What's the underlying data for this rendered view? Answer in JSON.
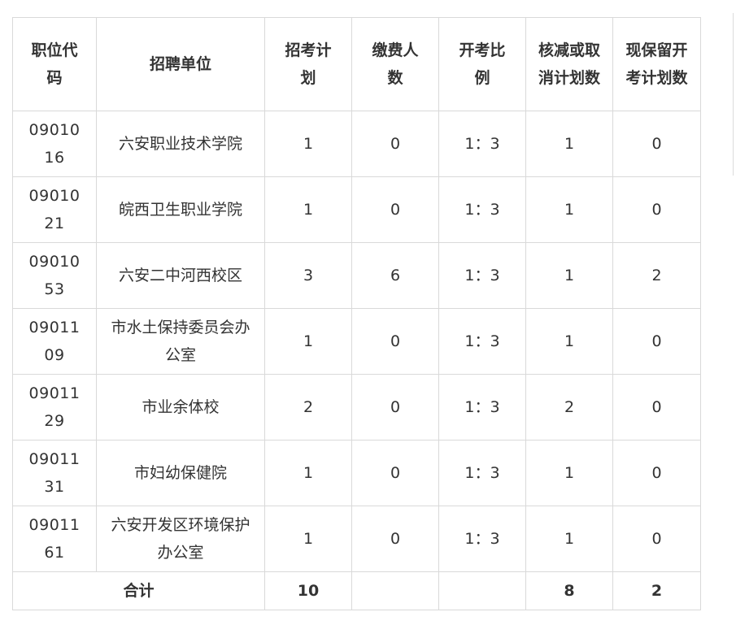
{
  "table": {
    "headers": {
      "code": "职位代码",
      "unit": "招聘单位",
      "plan": "招考计划",
      "paid": "缴费人数",
      "ratio": "开考比例",
      "cut": "核减或取消计划数",
      "kept": "现保留开考计划数"
    },
    "rows": [
      {
        "code": "0901016",
        "unit": "六安职业技术学院",
        "plan": "1",
        "paid": "0",
        "ratio": "1：3",
        "cut": "1",
        "kept": "0"
      },
      {
        "code": "0901021",
        "unit": "皖西卫生职业学院",
        "plan": "1",
        "paid": "0",
        "ratio": "1：3",
        "cut": "1",
        "kept": "0"
      },
      {
        "code": "0901053",
        "unit": "六安二中河西校区",
        "plan": "3",
        "paid": "6",
        "ratio": "1：3",
        "cut": "1",
        "kept": "2"
      },
      {
        "code": "0901109",
        "unit": "市水土保持委员会办公室",
        "plan": "1",
        "paid": "0",
        "ratio": "1：3",
        "cut": "1",
        "kept": "0"
      },
      {
        "code": "0901129",
        "unit": "市业余体校",
        "plan": "2",
        "paid": "0",
        "ratio": "1：3",
        "cut": "2",
        "kept": "0"
      },
      {
        "code": "0901131",
        "unit": "市妇幼保健院",
        "plan": "1",
        "paid": "0",
        "ratio": "1：3",
        "cut": "1",
        "kept": "0"
      },
      {
        "code": "0901161",
        "unit": "六安开发区环境保护办公室",
        "plan": "1",
        "paid": "0",
        "ratio": "1：3",
        "cut": "1",
        "kept": "0"
      }
    ],
    "total": {
      "label": "合计",
      "plan": "10",
      "paid": "",
      "ratio": "",
      "cut": "8",
      "kept": "2"
    }
  }
}
